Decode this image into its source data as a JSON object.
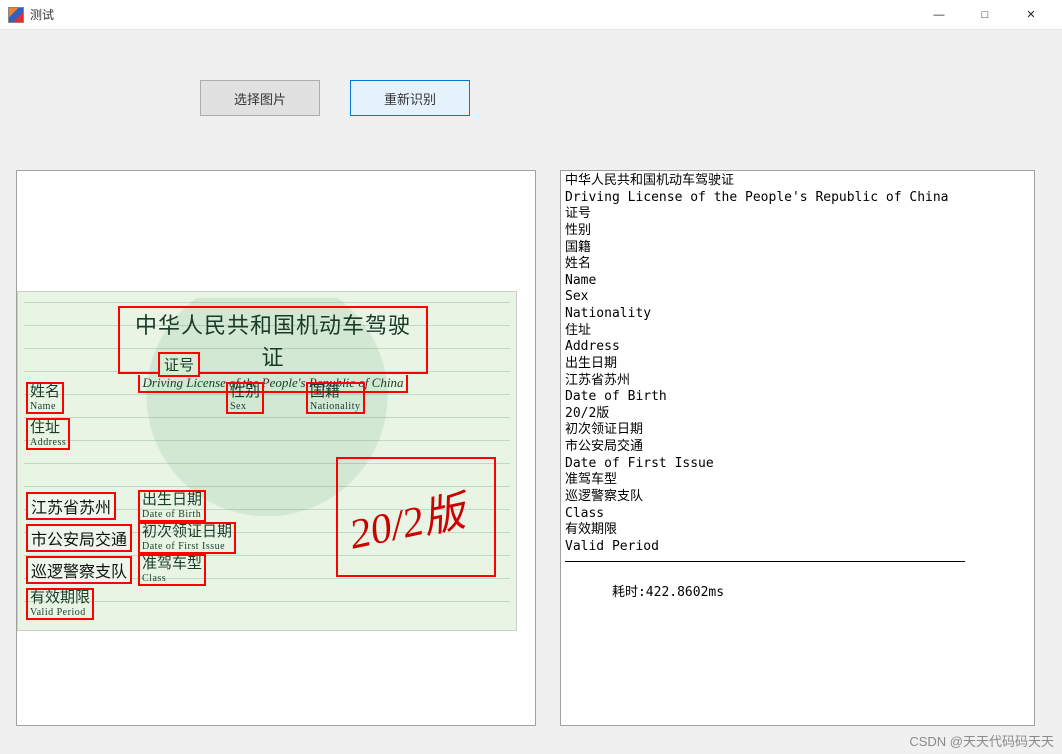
{
  "window": {
    "title": "测试",
    "min": "—",
    "max": "□",
    "close": "✕"
  },
  "toolbar": {
    "select_image": "选择图片",
    "recognize": "重新识别"
  },
  "license": {
    "title_cn": "中华人民共和国机动车驾驶证",
    "title_en": "Driving License of the People's Republic of China",
    "cert_no": "证号",
    "name_cn": "姓名",
    "name_en": "Name",
    "sex_cn": "性别",
    "sex_en": "Sex",
    "nat_cn": "国籍",
    "nat_en": "Nationality",
    "addr_cn": "住址",
    "addr_en": "Address",
    "dob_cn": "出生日期",
    "dob_en": "Date of Birth",
    "first_cn": "初次领证日期",
    "first_en": "Date of First Issue",
    "class_cn": "准驾车型",
    "class_en": "Class",
    "valid_cn": "有效期限",
    "valid_en": "Valid Period",
    "val_jiangsu": "江苏省苏州",
    "val_bureau": "市公安局交通",
    "val_police": "巡逻警察支队",
    "watermark": "20/2版"
  },
  "output": {
    "lines": [
      "中华人民共和国机动车驾驶证",
      "Driving License of the People's Republic of China",
      "证号",
      "性别",
      "国籍",
      "姓名",
      "Name",
      "Sex",
      "Nationality",
      "住址",
      "Address",
      "出生日期",
      "江苏省苏州",
      "Date of Birth",
      "20/2版",
      "初次领证日期",
      "市公安局交通",
      "Date of First Issue",
      "准驾车型",
      "巡逻警察支队",
      "Class",
      "有效期限",
      "Valid Period"
    ],
    "time_label": "耗时:",
    "time_value": "422.8602ms"
  },
  "footer": "CSDN @天天代码码天天"
}
